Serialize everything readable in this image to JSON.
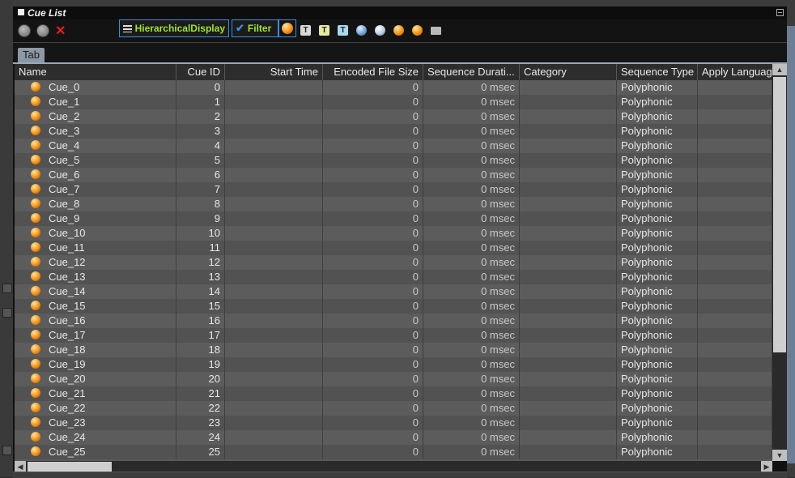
{
  "window": {
    "title": "Cue List"
  },
  "toolbar": {
    "hierarchical_label": "HierarchicalDisplay",
    "filter_label": "Filter",
    "icon_t_label": "T"
  },
  "tabs": [
    {
      "label": "Tab"
    }
  ],
  "columns": [
    {
      "label": "Name"
    },
    {
      "label": "Cue ID"
    },
    {
      "label": "Start Time"
    },
    {
      "label": "Encoded File Size"
    },
    {
      "label": "Sequence Durati..."
    },
    {
      "label": "Category"
    },
    {
      "label": "Sequence Type"
    },
    {
      "label": "Apply Language"
    }
  ],
  "rows": [
    {
      "name": "Cue_0",
      "id": "0",
      "start": "",
      "size": "0",
      "duration": "0 msec",
      "category": "",
      "type": "Polyphonic",
      "lang": ""
    },
    {
      "name": "Cue_1",
      "id": "1",
      "start": "",
      "size": "0",
      "duration": "0 msec",
      "category": "",
      "type": "Polyphonic",
      "lang": ""
    },
    {
      "name": "Cue_2",
      "id": "2",
      "start": "",
      "size": "0",
      "duration": "0 msec",
      "category": "",
      "type": "Polyphonic",
      "lang": ""
    },
    {
      "name": "Cue_3",
      "id": "3",
      "start": "",
      "size": "0",
      "duration": "0 msec",
      "category": "",
      "type": "Polyphonic",
      "lang": ""
    },
    {
      "name": "Cue_4",
      "id": "4",
      "start": "",
      "size": "0",
      "duration": "0 msec",
      "category": "",
      "type": "Polyphonic",
      "lang": ""
    },
    {
      "name": "Cue_5",
      "id": "5",
      "start": "",
      "size": "0",
      "duration": "0 msec",
      "category": "",
      "type": "Polyphonic",
      "lang": ""
    },
    {
      "name": "Cue_6",
      "id": "6",
      "start": "",
      "size": "0",
      "duration": "0 msec",
      "category": "",
      "type": "Polyphonic",
      "lang": ""
    },
    {
      "name": "Cue_7",
      "id": "7",
      "start": "",
      "size": "0",
      "duration": "0 msec",
      "category": "",
      "type": "Polyphonic",
      "lang": ""
    },
    {
      "name": "Cue_8",
      "id": "8",
      "start": "",
      "size": "0",
      "duration": "0 msec",
      "category": "",
      "type": "Polyphonic",
      "lang": ""
    },
    {
      "name": "Cue_9",
      "id": "9",
      "start": "",
      "size": "0",
      "duration": "0 msec",
      "category": "",
      "type": "Polyphonic",
      "lang": ""
    },
    {
      "name": "Cue_10",
      "id": "10",
      "start": "",
      "size": "0",
      "duration": "0 msec",
      "category": "",
      "type": "Polyphonic",
      "lang": ""
    },
    {
      "name": "Cue_11",
      "id": "11",
      "start": "",
      "size": "0",
      "duration": "0 msec",
      "category": "",
      "type": "Polyphonic",
      "lang": ""
    },
    {
      "name": "Cue_12",
      "id": "12",
      "start": "",
      "size": "0",
      "duration": "0 msec",
      "category": "",
      "type": "Polyphonic",
      "lang": ""
    },
    {
      "name": "Cue_13",
      "id": "13",
      "start": "",
      "size": "0",
      "duration": "0 msec",
      "category": "",
      "type": "Polyphonic",
      "lang": ""
    },
    {
      "name": "Cue_14",
      "id": "14",
      "start": "",
      "size": "0",
      "duration": "0 msec",
      "category": "",
      "type": "Polyphonic",
      "lang": ""
    },
    {
      "name": "Cue_15",
      "id": "15",
      "start": "",
      "size": "0",
      "duration": "0 msec",
      "category": "",
      "type": "Polyphonic",
      "lang": ""
    },
    {
      "name": "Cue_16",
      "id": "16",
      "start": "",
      "size": "0",
      "duration": "0 msec",
      "category": "",
      "type": "Polyphonic",
      "lang": ""
    },
    {
      "name": "Cue_17",
      "id": "17",
      "start": "",
      "size": "0",
      "duration": "0 msec",
      "category": "",
      "type": "Polyphonic",
      "lang": ""
    },
    {
      "name": "Cue_18",
      "id": "18",
      "start": "",
      "size": "0",
      "duration": "0 msec",
      "category": "",
      "type": "Polyphonic",
      "lang": ""
    },
    {
      "name": "Cue_19",
      "id": "19",
      "start": "",
      "size": "0",
      "duration": "0 msec",
      "category": "",
      "type": "Polyphonic",
      "lang": ""
    },
    {
      "name": "Cue_20",
      "id": "20",
      "start": "",
      "size": "0",
      "duration": "0 msec",
      "category": "",
      "type": "Polyphonic",
      "lang": ""
    },
    {
      "name": "Cue_21",
      "id": "21",
      "start": "",
      "size": "0",
      "duration": "0 msec",
      "category": "",
      "type": "Polyphonic",
      "lang": ""
    },
    {
      "name": "Cue_22",
      "id": "22",
      "start": "",
      "size": "0",
      "duration": "0 msec",
      "category": "",
      "type": "Polyphonic",
      "lang": ""
    },
    {
      "name": "Cue_23",
      "id": "23",
      "start": "",
      "size": "0",
      "duration": "0 msec",
      "category": "",
      "type": "Polyphonic",
      "lang": ""
    },
    {
      "name": "Cue_24",
      "id": "24",
      "start": "",
      "size": "0",
      "duration": "0 msec",
      "category": "",
      "type": "Polyphonic",
      "lang": ""
    },
    {
      "name": "Cue_25",
      "id": "25",
      "start": "",
      "size": "0",
      "duration": "0 msec",
      "category": "",
      "type": "Polyphonic",
      "lang": ""
    }
  ],
  "icons": {
    "cue": "orange-orb-icon",
    "nav_up": "arrow-up-circle-icon",
    "nav_down": "arrow-down-circle-icon",
    "delete": "red-x-icon"
  },
  "colors": {
    "accent": "#3a8fe0",
    "hierarchical_text": "#9fe23a",
    "cue_orb": "#f08a10"
  }
}
